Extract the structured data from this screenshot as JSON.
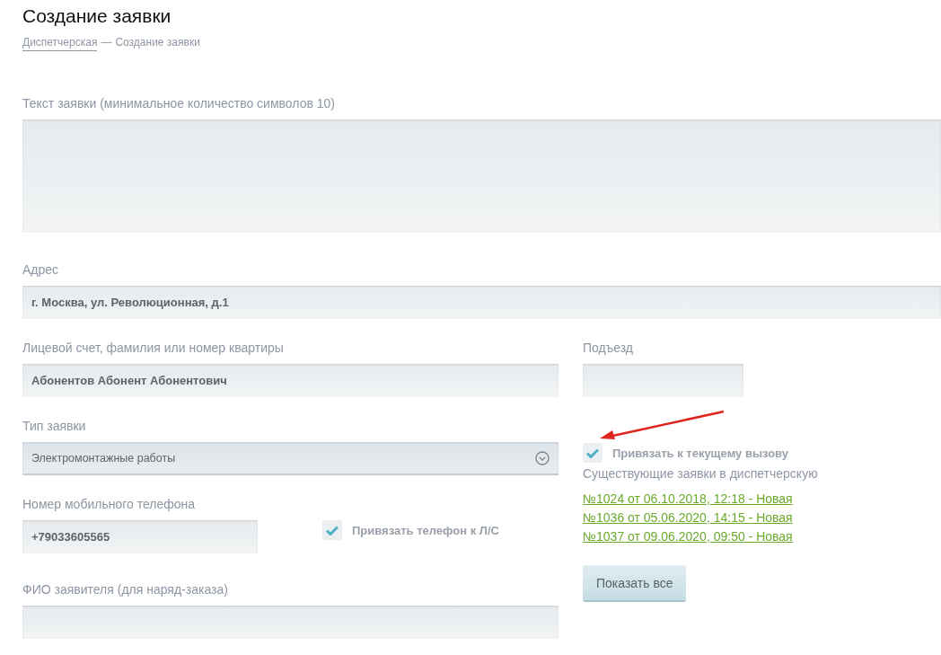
{
  "title": "Создание заявки",
  "breadcrumb": {
    "link": "Диспетчерская",
    "separator": "—",
    "current": "Создание заявки"
  },
  "request_text": {
    "label": "Текст заявки (минимальное количество символов 10)"
  },
  "address": {
    "label": "Адрес",
    "value": "г. Москва, ул. Революционная, д.1"
  },
  "account": {
    "label": "Лицевой счет, фамилия или номер квартиры",
    "value": "Абонентов Абонент Абонентович"
  },
  "entrance": {
    "label": "Подъезд"
  },
  "request_type": {
    "label": "Тип заявки",
    "value": "Электромонтажные работы"
  },
  "call_link": {
    "label": "Привязать к текущему вызову",
    "checked": true
  },
  "phone": {
    "label": "Номер мобильного телефона",
    "value": "+79033605565"
  },
  "phone_link": {
    "label": "Привязать телефон к Л/С",
    "checked": true
  },
  "existing_requests": {
    "label": "Существующие заявки в диспетчерскую",
    "links": [
      {
        "text": "№1024 от 06.10.2018, 12:18 - Новая"
      },
      {
        "text": "№1036 от 05.06.2020, 14:15 - Новая"
      },
      {
        "text": "№1037 от 09.06.2020, 09:50 - Новая"
      }
    ]
  },
  "show_all_button": "Показать все",
  "applicant": {
    "label": "ФИО заявителя (для наряд-заказа)"
  }
}
